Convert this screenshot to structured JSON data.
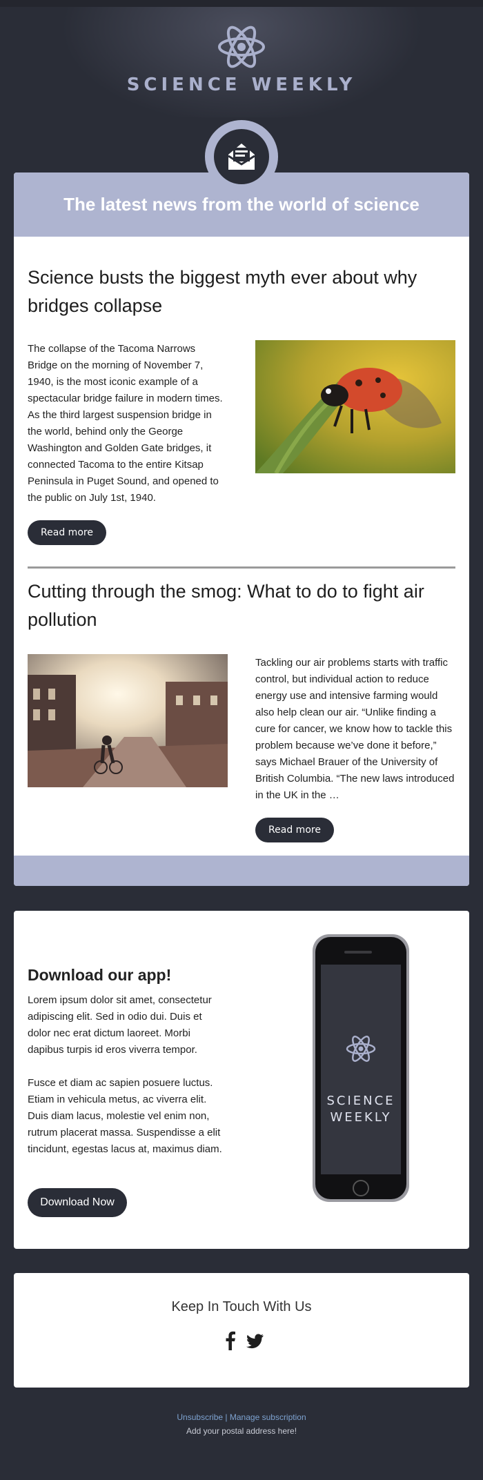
{
  "header": {
    "brand": "SCIENCE WEEKLY",
    "icon": "atom-icon",
    "accent": "#aeb4d0",
    "background": "#2a2d37"
  },
  "news": {
    "banner_title": "The latest news from the world of science",
    "badge_icon": "mail-icon",
    "articles": [
      {
        "title": "Science busts the biggest myth ever about why bridges collapse",
        "body": "The collapse of the Tacoma Narrows Bridge on the morning of November 7, 1940, is the most iconic example of a spectacular bridge failure in modern times. As the third largest suspension bridge in the world, behind only the George Washington and Golden Gate bridges, it connected Tacoma to the entire Kitsap Peninsula in Puget Sound, and opened to the public on July 1st, 1940.",
        "button": "Read more",
        "image": "ladybug-photo"
      },
      {
        "title": "Cutting through the smog: What to do to fight air pollution",
        "body": "Tackling our air problems starts with traffic control, but individual action to reduce energy use and intensive farming would also help clean our air. “Unlike finding a cure for cancer, we know how to tackle this problem because we’ve done it before,” says Michael Brauer of the University of British Columbia. “The new laws introduced in the UK in the …",
        "button": "Read more",
        "image": "city-cyclist-photo"
      }
    ]
  },
  "app": {
    "title": "Download our app!",
    "paragraph1": "Lorem ipsum dolor sit amet, consectetur adipiscing elit. Sed in odio dui. Duis et dolor nec erat dictum laoreet. Morbi dapibus turpis id eros viverra tempor.",
    "paragraph2": "Fusce et diam ac sapien posuere luctus. Etiam in vehicula metus, ac viverra elit. Duis diam lacus, molestie vel enim non, rutrum placerat massa. Suspendisse a elit tincidunt, egestas lacus at, maximus diam.",
    "button": "Download Now",
    "phone_brand_line1": "SCIENCE",
    "phone_brand_line2": "WEEKLY"
  },
  "social": {
    "title": "Keep In Touch With Us",
    "icons": [
      "facebook-icon",
      "twitter-icon"
    ]
  },
  "footer": {
    "unsubscribe": "Unsubscribe",
    "separator": "|",
    "manage": "Manage subscription",
    "address": "Add your postal address here!"
  }
}
